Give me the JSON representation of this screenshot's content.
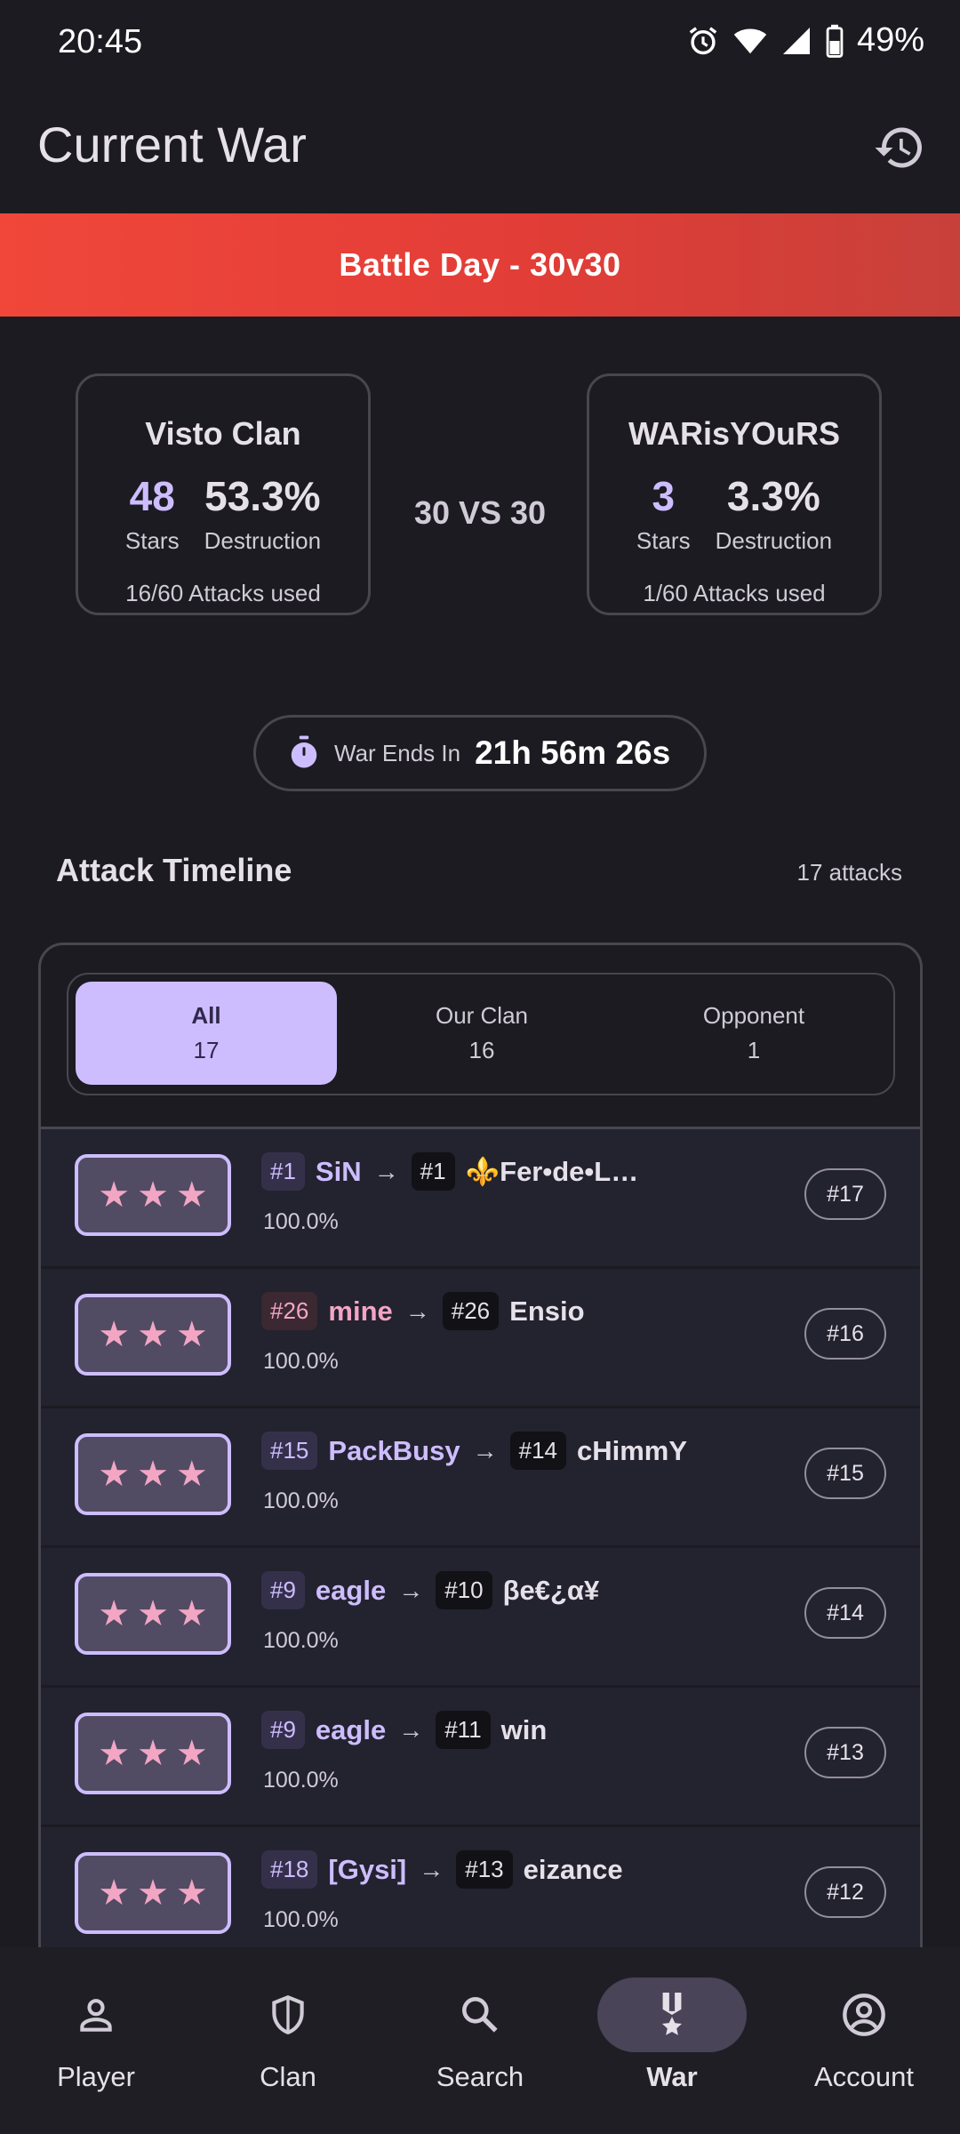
{
  "status_bar": {
    "time": "20:45",
    "battery": "49%"
  },
  "app_bar": {
    "title": "Current War"
  },
  "banner": {
    "text": "Battle Day - 30v30"
  },
  "clans": {
    "ours": {
      "name": "Visto Clan",
      "stars": "48",
      "destruction": "53.3%",
      "stars_label": "Stars",
      "destruction_label": "Destruction",
      "attacks_used": "16/60 Attacks used"
    },
    "theirs": {
      "name": "WARisYOuRS",
      "stars": "3",
      "destruction": "3.3%",
      "stars_label": "Stars",
      "destruction_label": "Destruction",
      "attacks_used": "1/60 Attacks used"
    },
    "vs": "30 VS 30"
  },
  "war_timer": {
    "label": "War Ends In",
    "value": "21h 56m 26s"
  },
  "timeline": {
    "title": "Attack Timeline",
    "count": "17 attacks",
    "filters": [
      {
        "label": "All",
        "count": "17"
      },
      {
        "label": "Our Clan",
        "count": "16"
      },
      {
        "label": "Opponent",
        "count": "1"
      }
    ],
    "attacks": [
      {
        "attacker_pos": "#1",
        "attacker": "SiN",
        "defender_pos": "#1",
        "defender": "⚜️Fer•de•L…",
        "percent": "100.0%",
        "order": "#17",
        "stars": 3
      },
      {
        "attacker_pos": "#26",
        "attacker": "mine",
        "defender_pos": "#26",
        "defender": "Ensio",
        "percent": "100.0%",
        "order": "#16",
        "stars": 3
      },
      {
        "attacker_pos": "#15",
        "attacker": "PackBusy",
        "defender_pos": "#14",
        "defender": "cHimmY",
        "percent": "100.0%",
        "order": "#15",
        "stars": 3
      },
      {
        "attacker_pos": "#9",
        "attacker": "eagle",
        "defender_pos": "#10",
        "defender": "βe€¿α¥",
        "percent": "100.0%",
        "order": "#14",
        "stars": 3
      },
      {
        "attacker_pos": "#9",
        "attacker": "eagle",
        "defender_pos": "#11",
        "defender": "win",
        "percent": "100.0%",
        "order": "#13",
        "stars": 3
      },
      {
        "attacker_pos": "#18",
        "attacker": "[Gysi]",
        "defender_pos": "#13",
        "defender": "eizance",
        "percent": "100.0%",
        "order": "#12",
        "stars": 3
      }
    ]
  },
  "bottom_nav": [
    {
      "label": "Player",
      "icon": "person-icon"
    },
    {
      "label": "Clan",
      "icon": "shield-icon"
    },
    {
      "label": "Search",
      "icon": "search-icon"
    },
    {
      "label": "War",
      "icon": "medal-icon"
    },
    {
      "label": "Account",
      "icon": "account-circle-icon"
    }
  ],
  "colors": {
    "accent": "#cdbdff",
    "banner": "#e5403a",
    "pink": "#f2a6c4",
    "background": "#1b1b21"
  }
}
